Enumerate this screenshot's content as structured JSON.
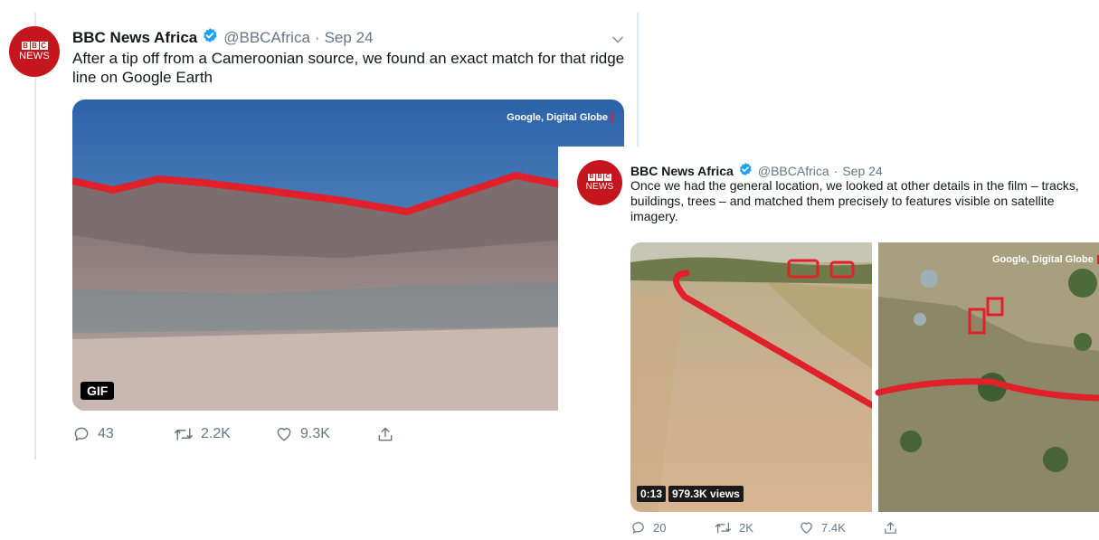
{
  "tweet1": {
    "avatar": {
      "logo_letters": [
        "B",
        "B",
        "C"
      ],
      "logo_word": "NEWS"
    },
    "name": "BBC News Africa",
    "handle": "@BBCAfrica",
    "separator": "·",
    "date": "Sep 24",
    "text": "After a tip off from a Cameroonian source, we found an exact match for that ridge line on Google Earth",
    "media": {
      "credit": "Google, Digital Globe",
      "badge": "GIF"
    },
    "actions": {
      "replies": "43",
      "retweets": "2.2K",
      "likes": "9.3K"
    }
  },
  "tweet2": {
    "avatar": {
      "logo_letters": [
        "B",
        "B",
        "C"
      ],
      "logo_word": "NEWS"
    },
    "name": "BBC News Africa",
    "handle": "@BBCAfrica",
    "separator": "·",
    "date": "Sep 24",
    "text": "Once we had the general location, we looked at other details in the film – tracks, buildings, trees – and matched them precisely to features visible on satellite imagery.",
    "media": {
      "credit": "Google, Digital Globe",
      "duration": "0:13",
      "views": "979.3K views"
    },
    "actions": {
      "replies": "20",
      "retweets": "2K",
      "likes": "7.4K"
    }
  },
  "colors": {
    "bbc_red": "#c4161c",
    "verified_blue": "#1da1f2",
    "annotation_red": "#e0202a",
    "meta_gray": "#657786"
  },
  "icons": [
    "reply-icon",
    "retweet-icon",
    "like-icon",
    "share-icon",
    "verified-icon",
    "chevron-down-icon"
  ]
}
